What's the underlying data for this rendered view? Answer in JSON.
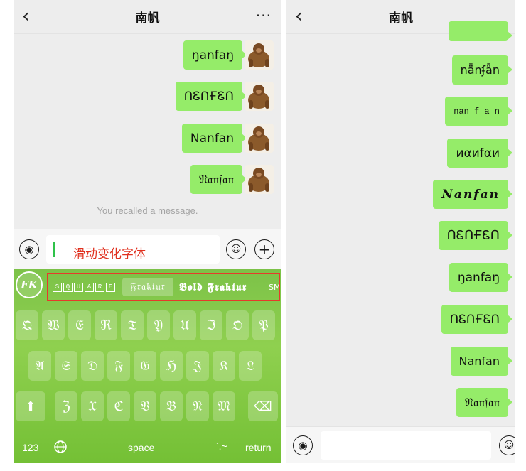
{
  "left": {
    "nav": {
      "back_icon": "‹",
      "title": "南帆",
      "more_icon": "···"
    },
    "messages": [
      {
        "text": "ŋanfaŋ"
      },
      {
        "text": "ՈᏋՈҒᏋՈ"
      },
      {
        "text": "Nanfan"
      },
      {
        "text": "𝔑𝔞𝔫𝔣𝔞𝔫"
      }
    ],
    "recall_notice": "You recalled a message.",
    "input": {
      "hint": "滑动变化字体",
      "voice_icon": "voice-icon",
      "emoji_icon": "emoji-icon",
      "plus_icon": "plus-icon"
    },
    "keyboard": {
      "logo": "FK",
      "styles": {
        "square": [
          "S",
          "Q",
          "U",
          "A",
          "R",
          "E"
        ],
        "fraktur": "𝔉𝔯𝔞𝔨𝔱𝔲𝔯",
        "bold_fraktur": "𝕭𝖔𝖑𝖉 𝕱𝖗𝖆𝖐𝖙𝖚𝖗",
        "sm": "SM"
      },
      "row1": [
        "𝔔",
        "𝔚",
        "𝔈",
        "ℜ",
        "𝔗",
        "𝔜",
        "𝔘",
        "ℑ",
        "𝔒",
        "𝔓"
      ],
      "row2": [
        "𝔄",
        "𝔖",
        "𝔇",
        "𝔉",
        "𝔊",
        "ℌ",
        "𝔍",
        "𝔎",
        "𝔏"
      ],
      "row3": [
        "ℨ",
        "𝔛",
        "ℭ",
        "𝔙",
        "𝔅",
        "𝔑",
        "𝔐"
      ],
      "shift_icon": "⬆",
      "delete_icon": "⌫",
      "bottom": {
        "num": "123",
        "globe_icon": "🌐",
        "space": "space",
        "punct": "`.~",
        "return": "return"
      }
    }
  },
  "right": {
    "nav": {
      "back_icon": "‹",
      "title": "南帆"
    },
    "messages": [
      {
        "text": "nǟnʄǟn"
      },
      {
        "text": "nan f a n"
      },
      {
        "text": "иαиfαи"
      },
      {
        "text": "𝑵𝒂𝒏𝒇𝒂𝒏"
      },
      {
        "text": "ՈᏋՈҒᏋՈ"
      },
      {
        "text": "ŋanfaŋ"
      },
      {
        "text": "ՈᏋՈҒᏋՈ"
      },
      {
        "text": "Nanfan"
      },
      {
        "text": "𝔑𝔞𝔫𝔣𝔞𝔫"
      }
    ]
  },
  "colors": {
    "bubble": "#95ec69",
    "keyboard": "#84c84a",
    "highlight": "#e63a2b",
    "hint": "#e0301e"
  }
}
